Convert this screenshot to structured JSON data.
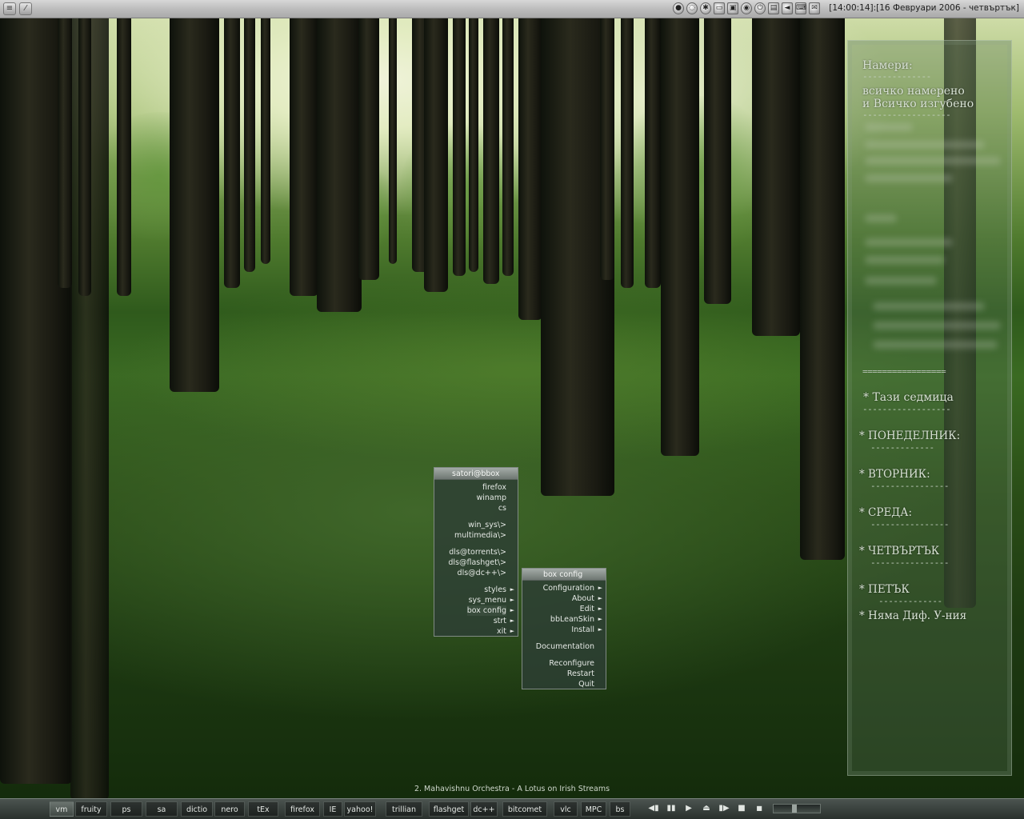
{
  "topbar": {
    "left_icons": [
      "blackbox-menu-icon",
      "workspace-icon"
    ],
    "tray_icons": [
      "globe-icon",
      "network-icon",
      "settings-icon",
      "display-icon",
      "image-icon",
      "firefox-icon",
      "power-icon",
      "doc-icon",
      "volume-icon",
      "keyboard-icon",
      "mail-icon"
    ],
    "clock": "[14:00:14]:[16 Февруари 2006 - четвъртък]"
  },
  "side_panel": {
    "heading": "Намери:",
    "heading_underline": "--------------",
    "line1": "всичко намерено",
    "line2": "и Всичко изгубено",
    "line2_underline": "------------------",
    "separator": "=================",
    "week_title": "* Тази седмица",
    "week_underline": "------------------",
    "days": [
      {
        "label": "* ПОНЕДЕЛНИК:",
        "underline": "-------------"
      },
      {
        "label": "* ВТОРНИК:",
        "underline": "----------------"
      },
      {
        "label": "* СРЕДА:",
        "underline": "----------------"
      },
      {
        "label": "* ЧЕТВЪРТЪК",
        "underline": "----------------"
      },
      {
        "label": "*  ПЕТЪК",
        "underline": "-------------"
      }
    ],
    "last_item": "*  Няма Диф. У-ния"
  },
  "root_menu": {
    "title": "satori@bbox",
    "items": [
      {
        "label": "firefox",
        "submenu": false
      },
      {
        "label": "winamp",
        "submenu": false
      },
      {
        "label": "cs",
        "submenu": false
      },
      {
        "label": "win_sys\\>",
        "submenu": false
      },
      {
        "label": "multimedia\\>",
        "submenu": false
      },
      {
        "label": "dls@torrents\\>",
        "submenu": false
      },
      {
        "label": "dls@flashget\\>",
        "submenu": false
      },
      {
        "label": "dls@dc++\\>",
        "submenu": false
      },
      {
        "label": "styles",
        "submenu": true
      },
      {
        "label": "sys_menu",
        "submenu": true
      },
      {
        "label": "box config",
        "submenu": true
      },
      {
        "label": "strt",
        "submenu": true
      },
      {
        "label": "xit",
        "submenu": true
      }
    ]
  },
  "config_menu": {
    "title": "box config",
    "items": [
      {
        "label": "Configuration",
        "submenu": true
      },
      {
        "label": "About",
        "submenu": true
      },
      {
        "label": "Edit",
        "submenu": true
      },
      {
        "label": "bbLeanSkin",
        "submenu": true
      },
      {
        "label": "Install",
        "submenu": true
      },
      {
        "label": "Documentation",
        "submenu": false
      },
      {
        "label": "Reconfigure",
        "submenu": false
      },
      {
        "label": "Restart",
        "submenu": false
      },
      {
        "label": "Quit",
        "submenu": false
      }
    ]
  },
  "now_playing": "2. Mahavishnu Orchestra - A Lotus on Irish Streams",
  "taskbar": {
    "tasks": [
      "vm",
      "fruity",
      "ps",
      "sa",
      "dictio",
      "nero",
      "tEx",
      "firefox",
      "IE",
      "yahoo!",
      "trillian",
      "flashget",
      "dc++",
      "bitcomet",
      "vlc",
      "MPC",
      "bs"
    ],
    "controls": [
      "prev-icon",
      "pause-icon",
      "play-icon",
      "eject-icon",
      "next-icon",
      "stop-icon"
    ],
    "control_glyphs": [
      "◀▮",
      "▮▮",
      "▶",
      "⏏",
      "▮▶",
      "■"
    ],
    "volume_level": 0.45
  },
  "colors": {
    "menu_bg": "#2d3e34",
    "menu_title": "#8e9691",
    "panel_text": "#d8e2d4",
    "topbar": "#c4c4c4"
  }
}
